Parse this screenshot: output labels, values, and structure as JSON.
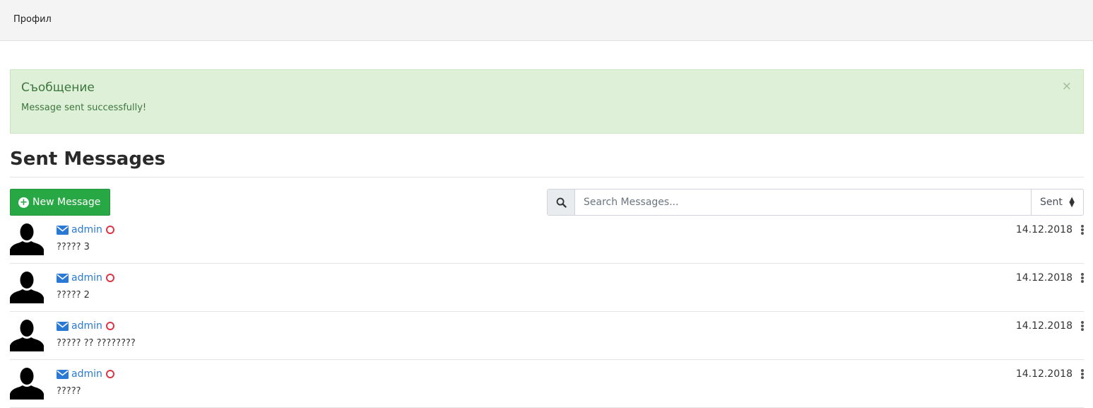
{
  "topbar": {
    "breadcrumb": "Профил"
  },
  "alert": {
    "title": "Съобщение",
    "message": "Message sent successfully!",
    "close_label": "×",
    "color": "#3c763d",
    "background": "#dff0d8"
  },
  "page": {
    "title": "Sent Messages"
  },
  "toolbar": {
    "new_message_label": "New Message",
    "new_message_icon": "plus-circle-icon",
    "search_icon": "search-icon",
    "search_placeholder": "Search Messages...",
    "filter_value": "Sent",
    "accent": "#28a745"
  },
  "messages": [
    {
      "sender": "admin",
      "subject": "????? 3",
      "date": "14.12.2018",
      "icon": "envelope-icon",
      "status": "circle-outline-icon"
    },
    {
      "sender": "admin",
      "subject": "????? 2",
      "date": "14.12.2018",
      "icon": "envelope-icon",
      "status": "circle-outline-icon"
    },
    {
      "sender": "admin",
      "subject": "????? ?? ????????",
      "date": "14.12.2018",
      "icon": "envelope-icon",
      "status": "circle-outline-icon"
    },
    {
      "sender": "admin",
      "subject": "?????",
      "date": "14.12.2018",
      "icon": "envelope-icon",
      "status": "circle-outline-icon"
    }
  ],
  "colors": {
    "link": "#2a7ad5",
    "status_outline": "#dc3545"
  }
}
